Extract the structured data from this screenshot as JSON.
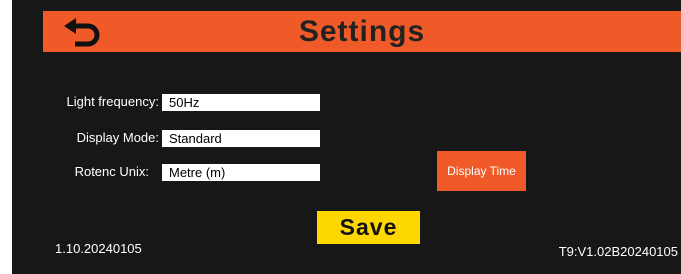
{
  "header": {
    "title": "Settings",
    "back_icon": "back-arrow-icon",
    "color": "#f05a28"
  },
  "fields": [
    {
      "label": "Light frequency:",
      "value": "50Hz"
    },
    {
      "label": "Display Mode:",
      "value": "Standard"
    },
    {
      "label": "Rotenc Unix:",
      "value": "Metre (m)"
    }
  ],
  "display_time_label": "Display Time",
  "save_label": "Save",
  "save_color": "#ffd700",
  "firmware_version": "1.10.20240105",
  "hardware_version": "T9:V1.02B20240105"
}
